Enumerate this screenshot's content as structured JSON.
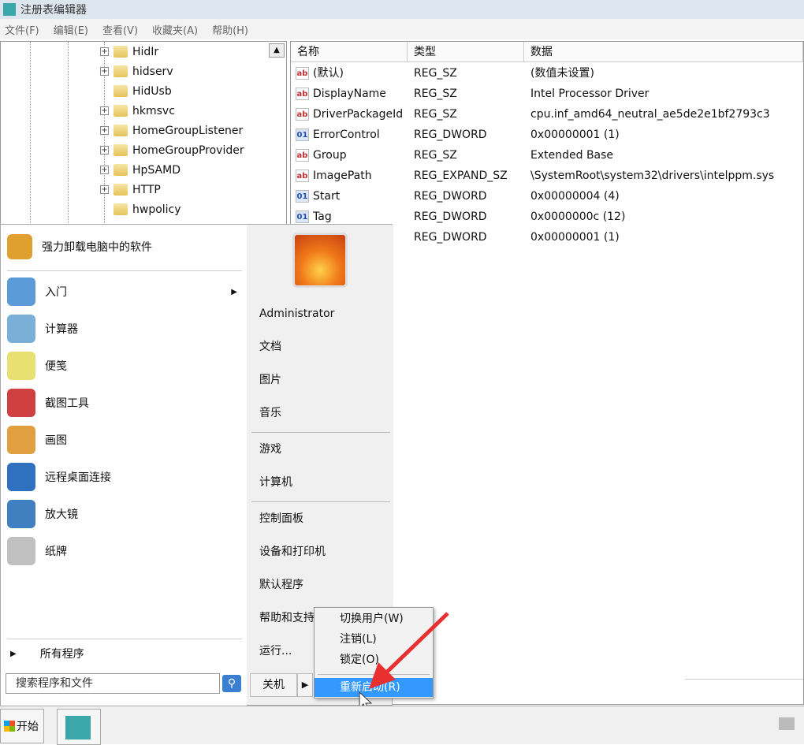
{
  "window": {
    "title": "注册表编辑器",
    "menu": [
      "文件(F)",
      "编辑(E)",
      "查看(V)",
      "收藏夹(A)",
      "帮助(H)"
    ]
  },
  "tree": {
    "nodes": [
      {
        "label": "HidIr",
        "expandable": true
      },
      {
        "label": "hidserv",
        "expandable": true
      },
      {
        "label": "HidUsb",
        "expandable": false
      },
      {
        "label": "hkmsvc",
        "expandable": true
      },
      {
        "label": "HomeGroupListener",
        "expandable": true
      },
      {
        "label": "HomeGroupProvider",
        "expandable": true
      },
      {
        "label": "HpSAMD",
        "expandable": true
      },
      {
        "label": "HTTP",
        "expandable": true
      },
      {
        "label": "hwpolicy",
        "expandable": false
      }
    ]
  },
  "values": {
    "headers": [
      "名称",
      "类型",
      "数据"
    ],
    "rows": [
      {
        "icon": "string-value-icon",
        "name": "(默认)",
        "type": "REG_SZ",
        "data": "(数值未设置)"
      },
      {
        "icon": "string-value-icon",
        "name": "DisplayName",
        "type": "REG_SZ",
        "data": "Intel Processor Driver"
      },
      {
        "icon": "string-value-icon",
        "name": "DriverPackageId",
        "type": "REG_SZ",
        "data": "cpu.inf_amd64_neutral_ae5de2e1bf2793c3"
      },
      {
        "icon": "binary-value-icon",
        "name": "ErrorControl",
        "type": "REG_DWORD",
        "data": "0x00000001 (1)"
      },
      {
        "icon": "string-value-icon",
        "name": "Group",
        "type": "REG_SZ",
        "data": "Extended Base"
      },
      {
        "icon": "string-value-icon",
        "name": "ImagePath",
        "type": "REG_EXPAND_SZ",
        "data": "\\SystemRoot\\system32\\drivers\\intelppm.sys"
      },
      {
        "icon": "binary-value-icon",
        "name": "Start",
        "type": "REG_DWORD",
        "data": "0x00000004 (4)"
      },
      {
        "icon": "binary-value-icon",
        "name": "Tag",
        "type": "REG_DWORD",
        "data": "0x0000000c (12)"
      },
      {
        "icon": "binary-value-icon",
        "name": "",
        "type": "REG_DWORD",
        "data": "0x00000001 (1)"
      }
    ]
  },
  "start_menu": {
    "pinned": {
      "label": "强力卸载电脑中的软件",
      "color": "#e0a030"
    },
    "programs": [
      {
        "label": "入门",
        "arrow": true,
        "color": "#5a9bd8"
      },
      {
        "label": "计算器",
        "color": "#7ab0d8"
      },
      {
        "label": "便笺",
        "color": "#e8e070"
      },
      {
        "label": "截图工具",
        "color": "#d04040"
      },
      {
        "label": "画图",
        "color": "#e0a040"
      },
      {
        "label": "远程桌面连接",
        "color": "#3070c0"
      },
      {
        "label": "放大镜",
        "color": "#4080c0"
      },
      {
        "label": "纸牌",
        "color": "#c0c0c0"
      }
    ],
    "all_programs": "所有程序",
    "search_placeholder": "搜索程序和文件",
    "right": [
      "Administrator",
      "文档",
      "图片",
      "音乐",
      "游戏",
      "计算机",
      "控制面板",
      "设备和打印机",
      "默认程序",
      "帮助和支持",
      "运行..."
    ],
    "shutdown": "关机"
  },
  "shutdown_menu": {
    "items": [
      "切换用户(W)",
      "注销(L)",
      "锁定(O)"
    ],
    "selected": "重新启动(R)",
    "highlight_color": "#3399ff"
  },
  "taskbar": {
    "start": "开始"
  },
  "annotation": {
    "arrow_color": "#e83030"
  }
}
